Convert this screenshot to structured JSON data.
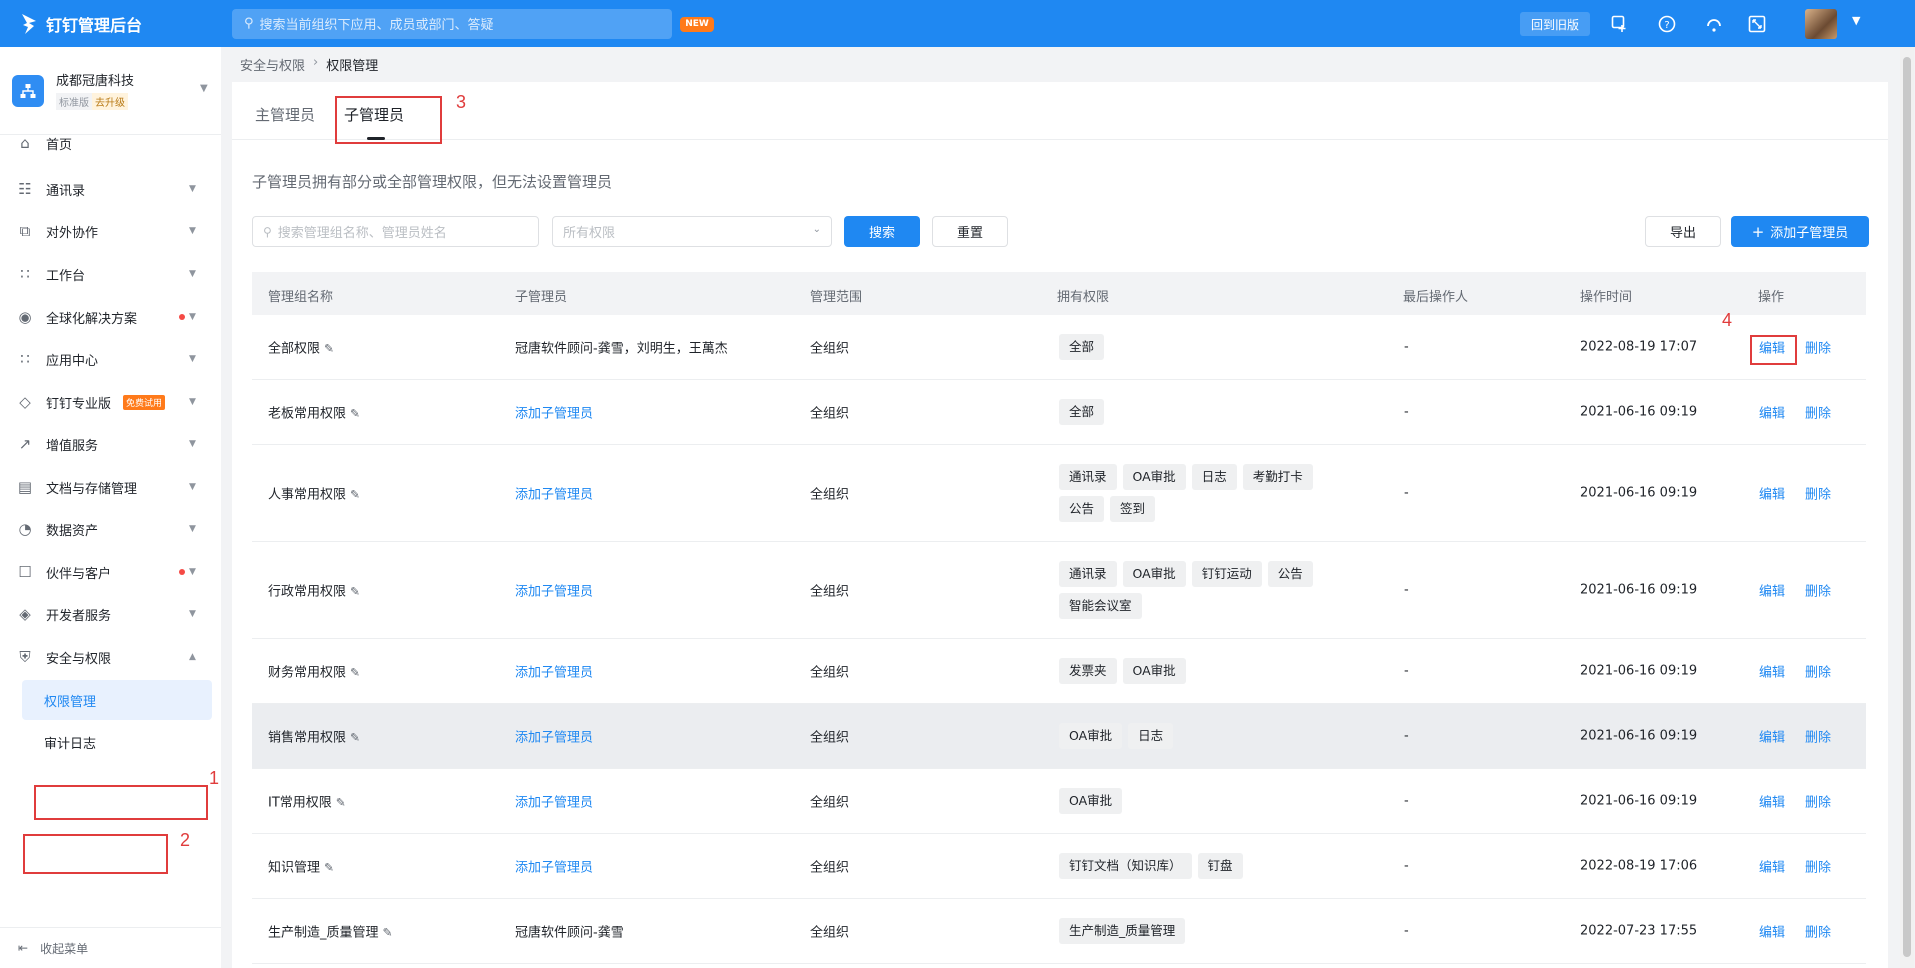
{
  "header": {
    "app_title": "钉钉管理后台",
    "search_placeholder": "搜索当前组织下应用、成员或部门、答疑",
    "new_badge": "NEW",
    "back_to_old": "回到旧版",
    "brand_color": "#1f88f2"
  },
  "org": {
    "name": "成都冠唐科技",
    "edition": "标准版",
    "upgrade": "去升级"
  },
  "sidebar": {
    "items": [
      {
        "label": "首页",
        "icon": "home-icon"
      },
      {
        "label": "通讯录",
        "icon": "contacts-icon"
      },
      {
        "label": "对外协作",
        "icon": "collaboration-icon"
      },
      {
        "label": "工作台",
        "icon": "workbench-icon"
      },
      {
        "label": "全球化解决方案",
        "icon": "globe-icon"
      },
      {
        "label": "应用中心",
        "icon": "app-center-icon"
      },
      {
        "label": "钉钉专业版",
        "icon": "diamond-icon",
        "tag": "免费试用"
      },
      {
        "label": "增值服务",
        "icon": "trend-icon"
      },
      {
        "label": "文档与存储管理",
        "icon": "storage-icon"
      },
      {
        "label": "数据资产",
        "icon": "data-icon"
      },
      {
        "label": "伙伴与客户",
        "icon": "partner-icon"
      },
      {
        "label": "开发者服务",
        "icon": "layers-icon"
      },
      {
        "label": "安全与权限",
        "icon": "shield-icon"
      }
    ],
    "sub_items": [
      {
        "label": "权限管理"
      },
      {
        "label": "审计日志"
      }
    ],
    "collapse": "收起菜单"
  },
  "breadcrumb": {
    "parent": "安全与权限",
    "current": "权限管理"
  },
  "tabs": {
    "main_admin": "主管理员",
    "sub_admin": "子管理员"
  },
  "description": "子管理员拥有部分或全部管理权限，但无法设置管理员",
  "filters": {
    "search_placeholder": "搜索管理组名称、管理员姓名",
    "permission_select": "所有权限",
    "search_button": "搜索",
    "reset_button": "重置",
    "export_button": "导出",
    "add_button": "添加子管理员"
  },
  "table": {
    "headers": [
      "管理组名称",
      "子管理员",
      "管理范围",
      "拥有权限",
      "最后操作人",
      "操作时间",
      "操作"
    ],
    "rows": [
      {
        "name": "全部权限",
        "admin": "冠唐软件顾问-龚雪，刘明生，王萬杰",
        "admin_link": false,
        "scope": "全组织",
        "perms": [
          "全部"
        ],
        "operator": "-",
        "time": "2022-08-19 17:07",
        "edit": "编辑",
        "delete": "删除"
      },
      {
        "name": "老板常用权限",
        "admin": "添加子管理员",
        "admin_link": true,
        "scope": "全组织",
        "perms": [
          "全部"
        ],
        "operator": "-",
        "time": "2021-06-16 09:19",
        "edit": "编辑",
        "delete": "删除"
      },
      {
        "name": "人事常用权限",
        "admin": "添加子管理员",
        "admin_link": true,
        "scope": "全组织",
        "perms": [
          "通讯录",
          "OA审批",
          "日志",
          "考勤打卡",
          "公告",
          "签到"
        ],
        "operator": "-",
        "time": "2021-06-16 09:19",
        "edit": "编辑",
        "delete": "删除"
      },
      {
        "name": "行政常用权限",
        "admin": "添加子管理员",
        "admin_link": true,
        "scope": "全组织",
        "perms": [
          "通讯录",
          "OA审批",
          "钉钉运动",
          "公告",
          "智能会议室"
        ],
        "operator": "-",
        "time": "2021-06-16 09:19",
        "edit": "编辑",
        "delete": "删除"
      },
      {
        "name": "财务常用权限",
        "admin": "添加子管理员",
        "admin_link": true,
        "scope": "全组织",
        "perms": [
          "发票夹",
          "OA审批"
        ],
        "operator": "-",
        "time": "2021-06-16 09:19",
        "edit": "编辑",
        "delete": "删除"
      },
      {
        "name": "销售常用权限",
        "admin": "添加子管理员",
        "admin_link": true,
        "scope": "全组织",
        "perms": [
          "OA审批",
          "日志"
        ],
        "operator": "-",
        "time": "2021-06-16 09:19",
        "edit": "编辑",
        "delete": "删除"
      },
      {
        "name": "IT常用权限",
        "admin": "添加子管理员",
        "admin_link": true,
        "scope": "全组织",
        "perms": [
          "OA审批"
        ],
        "operator": "-",
        "time": "2021-06-16 09:19",
        "edit": "编辑",
        "delete": "删除"
      },
      {
        "name": "知识管理",
        "admin": "添加子管理员",
        "admin_link": true,
        "scope": "全组织",
        "perms": [
          "钉钉文档（知识库）",
          "钉盘"
        ],
        "operator": "-",
        "time": "2022-08-19 17:06",
        "edit": "编辑",
        "delete": "删除"
      },
      {
        "name": "生产制造_质量管理",
        "admin": "冠唐软件顾问-龚雪",
        "admin_link": false,
        "scope": "全组织",
        "perms": [
          "生产制造_质量管理"
        ],
        "operator": "-",
        "time": "2022-07-23 17:55",
        "edit": "编辑",
        "delete": "删除"
      }
    ]
  },
  "annotations": [
    "1",
    "2",
    "3",
    "4"
  ],
  "annotation_color": "#e03c3c"
}
